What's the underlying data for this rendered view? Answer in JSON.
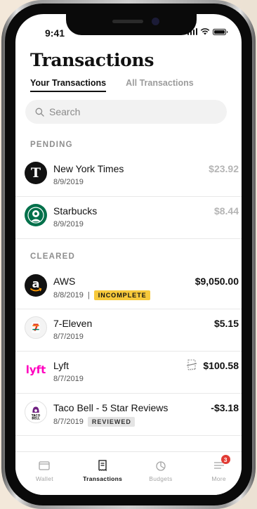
{
  "status": {
    "time": "9:41"
  },
  "header": {
    "title": "Transactions",
    "tabs": [
      {
        "label": "Your Transactions",
        "active": true
      },
      {
        "label": "All Transactions",
        "active": false
      }
    ]
  },
  "search": {
    "placeholder": "Search"
  },
  "pending": {
    "label": "PENDING",
    "items": [
      {
        "name": "New York Times",
        "date": "8/9/2019",
        "amount": "$23.92",
        "logo": "nyt-logo"
      },
      {
        "name": "Starbucks",
        "date": "8/9/2019",
        "amount": "$8.44",
        "logo": "starbucks-logo"
      }
    ]
  },
  "cleared": {
    "label": "CLEARED",
    "items": [
      {
        "name": "AWS",
        "date": "8/8/2019",
        "separator": "|",
        "badge": "INCOMPLETE",
        "amount": "$9,050.00",
        "logo": "amazon-logo"
      },
      {
        "name": "7-Eleven",
        "date": "8/7/2019",
        "amount": "$5.15",
        "logo": "seven-eleven-logo"
      },
      {
        "name": "Lyft",
        "date": "8/7/2019",
        "amount": "$100.58",
        "logo": "lyft-logo",
        "icon": "receipt-missing-icon"
      },
      {
        "name": "Taco Bell - 5 Star Reviews",
        "date": "8/7/2019",
        "badge": "REVIEWED",
        "amount": "-$3.18",
        "logo": "taco-bell-logo"
      }
    ]
  },
  "tabbar": {
    "items": [
      {
        "label": "Wallet",
        "icon": "wallet-icon"
      },
      {
        "label": "Transactions",
        "icon": "receipt-icon",
        "active": true
      },
      {
        "label": "Budgets",
        "icon": "pie-chart-icon"
      },
      {
        "label": "More",
        "icon": "menu-icon",
        "badge": "3"
      }
    ]
  },
  "colors": {
    "incomplete": "#f7c93b",
    "notification": "#e13b34",
    "starbucks": "#00704a",
    "lyft": "#ff00bf"
  }
}
